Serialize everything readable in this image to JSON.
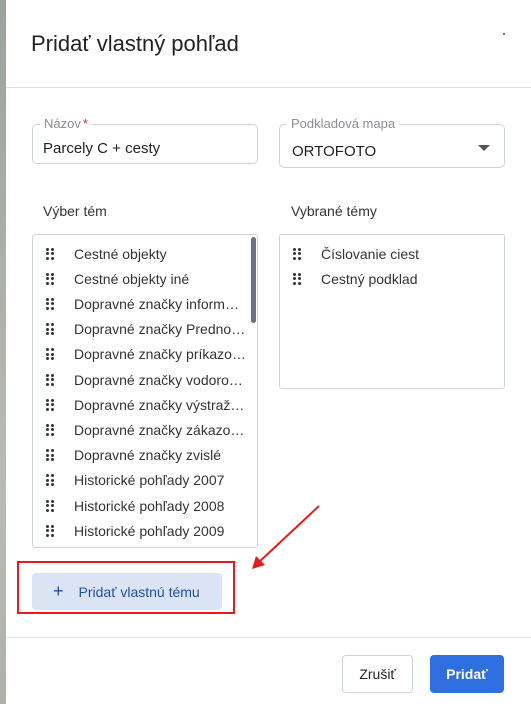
{
  "dialog": {
    "title": "Pridať vlastný pohľad"
  },
  "form": {
    "name_label": "Názov",
    "name_required_mark": "*",
    "name_value": "Parcely C + cesty",
    "basemap_label": "Podkladová mapa",
    "basemap_value": "ORTOFOTO"
  },
  "theme_selection": {
    "title": "Výber tém",
    "items": [
      "Cestné objekty",
      "Cestné objekty iné",
      "Dopravné značky inform…",
      "Dopravné značky Predno…",
      "Dopravné značky príkazo…",
      "Dopravné značky vodoro…",
      "Dopravné značky výstraž…",
      "Dopravné značky zákazo…",
      "Dopravné značky zvislé",
      "Historické pohľady 2007",
      "Historické pohľady 2008",
      "Historické pohľady 2009"
    ]
  },
  "selected_themes": {
    "title": "Vybrané témy",
    "items": [
      "Číslovanie ciest",
      "Cestný podklad"
    ]
  },
  "actions": {
    "add_custom_theme": "Pridať vlastnú tému",
    "add_custom_theme_icon": "plus-icon",
    "cancel": "Zrušiť",
    "submit": "Pridať"
  },
  "colors": {
    "primary": "#2f6ee0",
    "highlight": "#e11d1d",
    "secondary_button_bg": "#dbe4f4"
  }
}
